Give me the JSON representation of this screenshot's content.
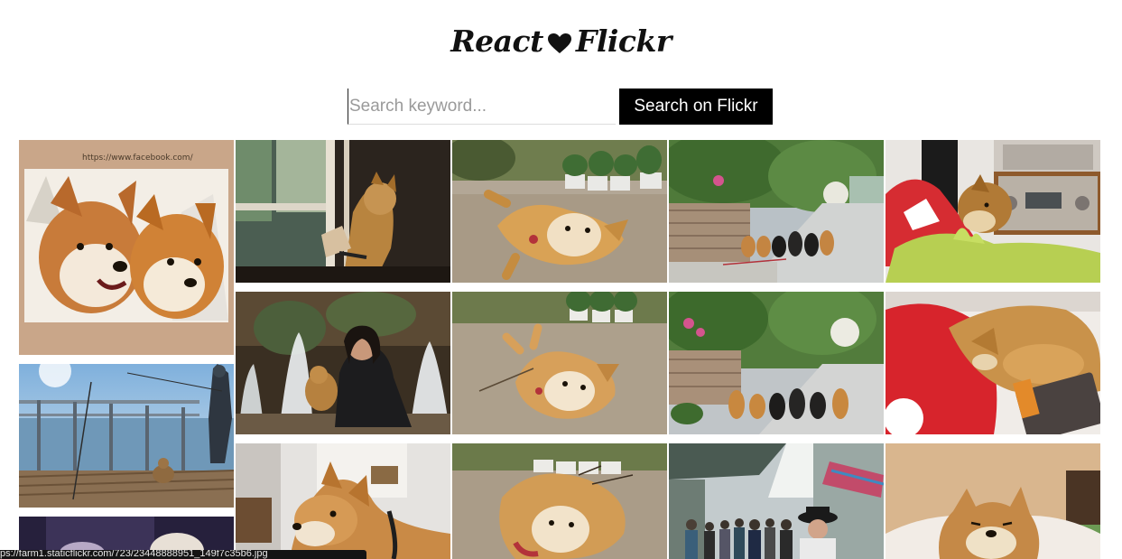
{
  "header": {
    "title_left": "React",
    "title_right": "Flickr",
    "heart_icon": "heart-icon"
  },
  "search": {
    "placeholder": "Search keyword...",
    "value": "",
    "button_label": "Search on Flickr"
  },
  "gallery": {
    "photos": [
      {
        "subject": "akita-dogs-painting",
        "caption_visible": "https://www.facebook.com/"
      },
      {
        "subject": "shiba-window"
      },
      {
        "subject": "shiba-lying-on-ground"
      },
      {
        "subject": "shiba-group-street"
      },
      {
        "subject": "shiba-sleeping-red-blanket"
      },
      {
        "subject": "fishing-pier-shiba"
      },
      {
        "subject": "woman-with-shiba-fountains"
      },
      {
        "subject": "shiba-rolling-ground"
      },
      {
        "subject": "shiba-group-street-2"
      },
      {
        "subject": "shiba-on-red-cushion"
      },
      {
        "subject": "dark-photo-partial"
      },
      {
        "subject": "shiba-indoors-portrait"
      },
      {
        "subject": "shiba-rolling-ground-3"
      },
      {
        "subject": "crowd-under-umbrella"
      },
      {
        "subject": "shiba-in-bed"
      }
    ]
  },
  "status_bar": {
    "url_text": "ps://farm1.staticflickr.com/723/23448888951_149f7c35b6.jpg"
  },
  "colors": {
    "button_bg": "#000000",
    "button_text": "#ffffff",
    "placeholder": "#9a9a9a",
    "status_bar_bg": "#141414"
  }
}
